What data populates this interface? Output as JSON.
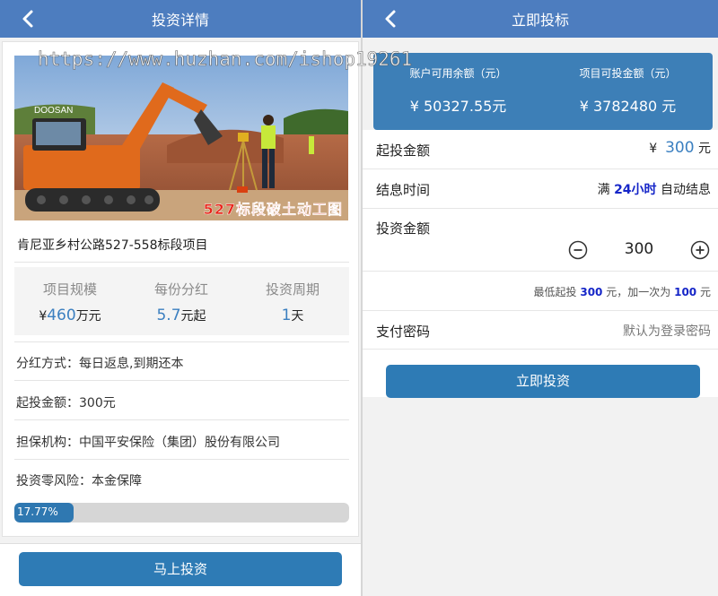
{
  "left": {
    "title": "投资详情",
    "photo_caption": "527标段破土动工图",
    "watermark": "https://www.huzhan.com/ishop19261",
    "project_name": "肯尼亚乡村公路527-558标段项目",
    "stats": [
      {
        "label": "项目规模",
        "prefix": "¥",
        "value": "460",
        "suffix": "万元"
      },
      {
        "label": "每份分红",
        "prefix": "",
        "value": "5.7",
        "suffix": "元起"
      },
      {
        "label": "投资周期",
        "prefix": "",
        "value": "1",
        "suffix": "天"
      }
    ],
    "info_rows": [
      "分红方式：每日返息,到期还本",
      "起投金额：300元",
      "担保机构：中国平安保险（集团）股份有限公司",
      "投资零风险：本金保障"
    ],
    "progress": {
      "text": "17.77%",
      "fraction": 0.1777
    },
    "invest_button": "马上投资"
  },
  "right": {
    "title": "立即投标",
    "balance": {
      "account_label": "账户可用余额（元）",
      "account_value": "¥ 50327.55元",
      "project_label": "项目可投金额（元）",
      "project_value": "¥ 3782480 元"
    },
    "min_invest": {
      "label": "起投金额",
      "currency": "¥",
      "value": "300",
      "unit": "元"
    },
    "settle": {
      "label": "结息时间",
      "prefix": "满",
      "value": "24小时",
      "suffix": "自动结息"
    },
    "amount": {
      "label": "投资金额",
      "value": "300"
    },
    "hint": {
      "p1": "最低起投",
      "min": "300",
      "p2": "元，加一次为",
      "step": "100",
      "p3": "元"
    },
    "password": {
      "label": "支付密码",
      "placeholder": "默认为登录密码"
    },
    "submit_button": "立即投资"
  },
  "colors": {
    "nav": "#4d7dbf",
    "button": "#2e7bb5",
    "accent_blue": "#3a7fc0",
    "strong_blue": "#1626c8",
    "caption_red": "#e8251a"
  },
  "icons": [
    "back-arrow-icon",
    "minus-circle-icon",
    "plus-circle-icon"
  ]
}
